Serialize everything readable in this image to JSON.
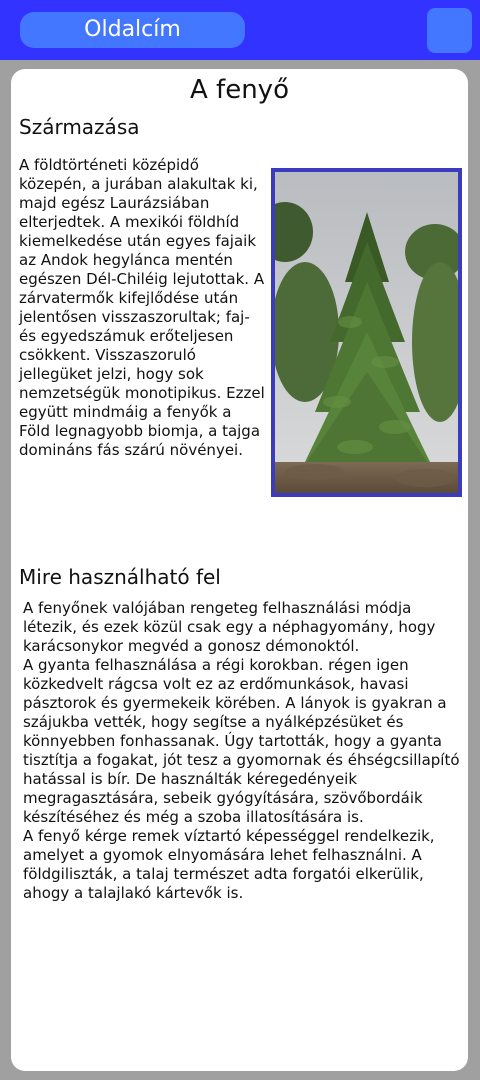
{
  "header": {
    "title": "Oldalcím",
    "menu_button_icon": "menu-icon"
  },
  "main": {
    "title": "A fenyő",
    "sections": [
      {
        "heading": "Származása",
        "text": "A földtörténeti középidő közepén, a jurában alakultak ki, majd egész Laurázsiában elterjedtek. A mexikói földhíd kiemelkedése után egyes fajaik az Andok hegylánca mentén egészen Dél-Chiléig lejutottak. A zárvatermők kifejlődése után jelentősen visszaszorultak; faj- és egyedszámuk erőteljesen csökkent. Visszaszoruló jellegüket jelzi, hogy sok nemzetségük monotipikus. Ezzel együtt mindmáig a fenyők a Föld legnagyobb biomja, a tajga domináns fás szárú növényei."
      },
      {
        "heading": "Mire használható fel",
        "text": "A fenyőnek valójában rengeteg felhasználási módja létezik, és ezek közül csak egy a néphagyomány, hogy karácsonykor megvéd a gonosz démonoktól.\nA gyanta felhasználása a régi korokban. régen igen közkedvelt rágcsa volt ez az erdőmunkások, havasi pásztorok és gyermekeik körében. A lányok is gyakran a szájukba vették, hogy segítse a nyálképzésüket és könnyebben fonhassanak. Úgy tartották, hogy a gyanta tisztítja a fogakat, jót tesz a gyomornak és éhségcsillapító hatással is bír. De használták kéregedényeik megragasztására, sebeik gyógyítására, szövőbordáik készítéséhez és még a szoba illatosítására is.\nA fenyő kérge remek víztartó képességgel rendelkezik, amelyet a gyomok elnyomására lehet felhasználni. A földgiliszták, a talaj természet adta forgatói elkerülik, ahogy a talajlakó  kártevők is."
      }
    ],
    "image": {
      "subject": "fir tree photo",
      "border_color": "#3b3bbd"
    }
  },
  "colors": {
    "topbar": "#3333ff",
    "accent": "#4477ff",
    "background": "#a0a0a0",
    "card": "#ffffff"
  }
}
